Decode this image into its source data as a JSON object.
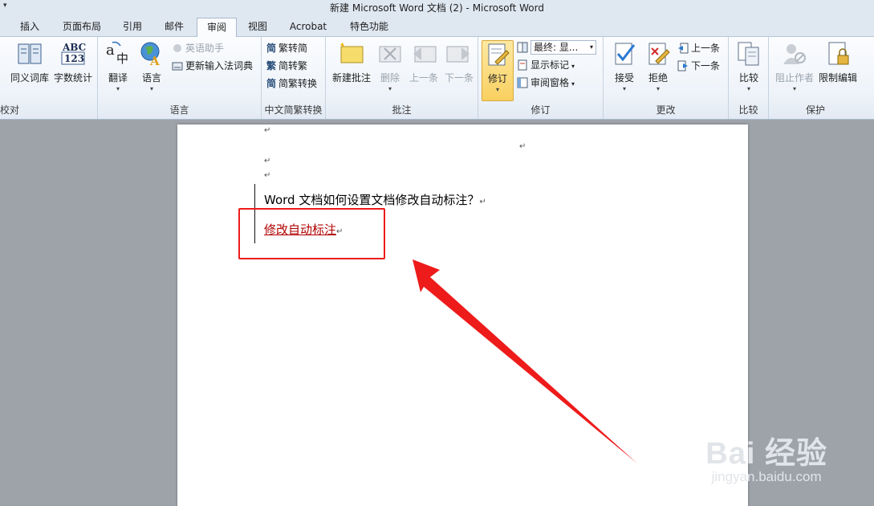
{
  "window": {
    "title": "新建 Microsoft Word 文档 (2)  -  Microsoft Word"
  },
  "tabs": [
    {
      "label": "插入"
    },
    {
      "label": "页面布局"
    },
    {
      "label": "引用"
    },
    {
      "label": "邮件"
    },
    {
      "label": "审阅",
      "active": true
    },
    {
      "label": "视图"
    },
    {
      "label": "Acrobat"
    },
    {
      "label": "特色功能"
    }
  ],
  "ribbon": {
    "proofing": {
      "label": "校对",
      "thesaurus": "同义词库",
      "wordcount": "字数统计"
    },
    "language": {
      "label": "语言",
      "translate": "翻译",
      "language": "语言",
      "english_assistant": "英语助手",
      "update_ime": "更新输入法词典"
    },
    "chinese_conversion": {
      "label": "中文简繁转换",
      "trad_to_simp": "繁转简",
      "simp_to_trad": "简转繁",
      "conversion": "简繁转换"
    },
    "comments": {
      "label": "批注",
      "new": "新建批注",
      "delete": "删除",
      "prev": "上一条",
      "next": "下一条"
    },
    "tracking": {
      "label": "修订",
      "track_changes": "修订",
      "display_for_review": "最终: 显...",
      "show_markup": "显示标记",
      "reviewing_pane": "审阅窗格"
    },
    "changes": {
      "label": "更改",
      "accept": "接受",
      "reject": "拒绝",
      "prev": "上一条",
      "next": "下一条"
    },
    "compare": {
      "label": "比较",
      "compare": "比较"
    },
    "protect": {
      "label": "保护",
      "block_authors": "阻止作者",
      "restrict_editing": "限制编辑"
    }
  },
  "document": {
    "line1": "Word 文档如何设置文档修改自动标注？",
    "line2": "修改自动标注",
    "paragraph_mark": "↵"
  },
  "watermark": {
    "brand": "Bai  经验",
    "url": "jingyan.baidu.com"
  },
  "colors": {
    "annotation_red": "#ee1b1b",
    "revision_red": "#b00000"
  }
}
